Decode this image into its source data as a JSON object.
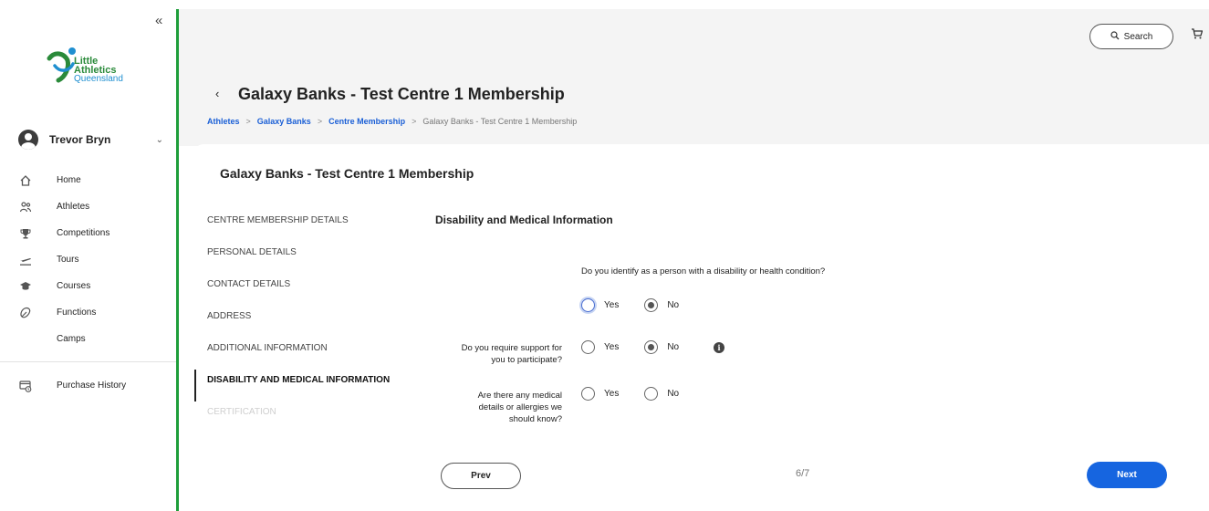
{
  "sidebar": {
    "collapse_symbol": "«",
    "logo": {
      "line1": "Little",
      "line2": "Athletics",
      "line3": "Queensland"
    },
    "user": {
      "name": "Trevor Bryn"
    },
    "nav": [
      {
        "label": "Home",
        "icon": "home-icon"
      },
      {
        "label": "Athletes",
        "icon": "athletes-icon"
      },
      {
        "label": "Competitions",
        "icon": "trophy-icon"
      },
      {
        "label": "Tours",
        "icon": "plane-icon"
      },
      {
        "label": "Courses",
        "icon": "graduation-cap-icon"
      },
      {
        "label": "Functions",
        "icon": "functions-icon"
      },
      {
        "label": "Camps",
        "icon": ""
      }
    ],
    "purchase_history": {
      "label": "Purchase History",
      "icon": "purchase-history-icon"
    }
  },
  "header": {
    "search_label": "Search",
    "back_symbol": "‹",
    "title": "Galaxy Banks - Test Centre 1 Membership",
    "breadcrumb": [
      "Athletes",
      "Galaxy Banks",
      "Centre Membership",
      "Galaxy Banks - Test Centre 1 Membership"
    ],
    "breadcrumb_sep": ">"
  },
  "card": {
    "title": "Galaxy Banks - Test Centre 1 Membership",
    "steps": [
      {
        "label": "CENTRE MEMBERSHIP DETAILS",
        "state": "normal"
      },
      {
        "label": "PERSONAL DETAILS",
        "state": "normal"
      },
      {
        "label": "CONTACT DETAILS",
        "state": "normal"
      },
      {
        "label": "ADDRESS",
        "state": "normal"
      },
      {
        "label": "ADDITIONAL INFORMATION",
        "state": "normal"
      },
      {
        "label": "DISABILITY AND MEDICAL INFORMATION",
        "state": "active"
      },
      {
        "label": "CERTIFICATION",
        "state": "disabled"
      }
    ],
    "section_title": "Disability and Medical Information",
    "questions": {
      "q1": {
        "text": "Do you identify as a person with a disability or health condition?",
        "yes": "Yes",
        "no": "No",
        "selected": "No"
      },
      "q2": {
        "line1": "Do you require support for",
        "line2": "you to participate?",
        "yes": "Yes",
        "no": "No",
        "selected": "No"
      },
      "q3": {
        "line1": "Are there any medical",
        "line2": "details or allergies we",
        "line3": "should know?",
        "yes": "Yes",
        "no": "No",
        "selected": ""
      }
    },
    "prev_label": "Prev",
    "next_label": "Next",
    "page_count": "6/7"
  },
  "colors": {
    "accent_green": "#1e9e3a",
    "link_blue": "#1a5fd6",
    "primary_button": "#1665e0"
  }
}
